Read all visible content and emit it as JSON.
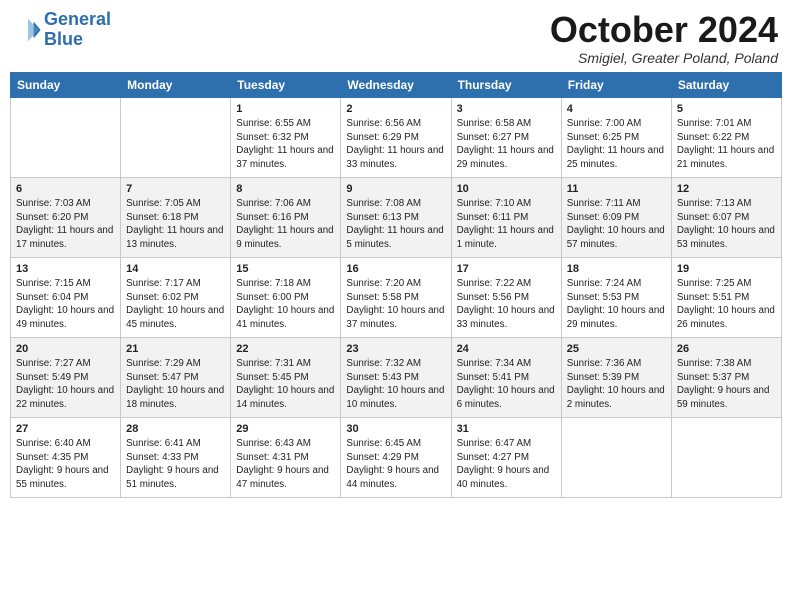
{
  "header": {
    "logo_line1": "General",
    "logo_line2": "Blue",
    "month": "October 2024",
    "location": "Smigiel, Greater Poland, Poland"
  },
  "weekdays": [
    "Sunday",
    "Monday",
    "Tuesday",
    "Wednesday",
    "Thursday",
    "Friday",
    "Saturday"
  ],
  "weeks": [
    [
      {
        "day": "",
        "info": ""
      },
      {
        "day": "",
        "info": ""
      },
      {
        "day": "1",
        "info": "Sunrise: 6:55 AM\nSunset: 6:32 PM\nDaylight: 11 hours and 37 minutes."
      },
      {
        "day": "2",
        "info": "Sunrise: 6:56 AM\nSunset: 6:29 PM\nDaylight: 11 hours and 33 minutes."
      },
      {
        "day": "3",
        "info": "Sunrise: 6:58 AM\nSunset: 6:27 PM\nDaylight: 11 hours and 29 minutes."
      },
      {
        "day": "4",
        "info": "Sunrise: 7:00 AM\nSunset: 6:25 PM\nDaylight: 11 hours and 25 minutes."
      },
      {
        "day": "5",
        "info": "Sunrise: 7:01 AM\nSunset: 6:22 PM\nDaylight: 11 hours and 21 minutes."
      }
    ],
    [
      {
        "day": "6",
        "info": "Sunrise: 7:03 AM\nSunset: 6:20 PM\nDaylight: 11 hours and 17 minutes."
      },
      {
        "day": "7",
        "info": "Sunrise: 7:05 AM\nSunset: 6:18 PM\nDaylight: 11 hours and 13 minutes."
      },
      {
        "day": "8",
        "info": "Sunrise: 7:06 AM\nSunset: 6:16 PM\nDaylight: 11 hours and 9 minutes."
      },
      {
        "day": "9",
        "info": "Sunrise: 7:08 AM\nSunset: 6:13 PM\nDaylight: 11 hours and 5 minutes."
      },
      {
        "day": "10",
        "info": "Sunrise: 7:10 AM\nSunset: 6:11 PM\nDaylight: 11 hours and 1 minute."
      },
      {
        "day": "11",
        "info": "Sunrise: 7:11 AM\nSunset: 6:09 PM\nDaylight: 10 hours and 57 minutes."
      },
      {
        "day": "12",
        "info": "Sunrise: 7:13 AM\nSunset: 6:07 PM\nDaylight: 10 hours and 53 minutes."
      }
    ],
    [
      {
        "day": "13",
        "info": "Sunrise: 7:15 AM\nSunset: 6:04 PM\nDaylight: 10 hours and 49 minutes."
      },
      {
        "day": "14",
        "info": "Sunrise: 7:17 AM\nSunset: 6:02 PM\nDaylight: 10 hours and 45 minutes."
      },
      {
        "day": "15",
        "info": "Sunrise: 7:18 AM\nSunset: 6:00 PM\nDaylight: 10 hours and 41 minutes."
      },
      {
        "day": "16",
        "info": "Sunrise: 7:20 AM\nSunset: 5:58 PM\nDaylight: 10 hours and 37 minutes."
      },
      {
        "day": "17",
        "info": "Sunrise: 7:22 AM\nSunset: 5:56 PM\nDaylight: 10 hours and 33 minutes."
      },
      {
        "day": "18",
        "info": "Sunrise: 7:24 AM\nSunset: 5:53 PM\nDaylight: 10 hours and 29 minutes."
      },
      {
        "day": "19",
        "info": "Sunrise: 7:25 AM\nSunset: 5:51 PM\nDaylight: 10 hours and 26 minutes."
      }
    ],
    [
      {
        "day": "20",
        "info": "Sunrise: 7:27 AM\nSunset: 5:49 PM\nDaylight: 10 hours and 22 minutes."
      },
      {
        "day": "21",
        "info": "Sunrise: 7:29 AM\nSunset: 5:47 PM\nDaylight: 10 hours and 18 minutes."
      },
      {
        "day": "22",
        "info": "Sunrise: 7:31 AM\nSunset: 5:45 PM\nDaylight: 10 hours and 14 minutes."
      },
      {
        "day": "23",
        "info": "Sunrise: 7:32 AM\nSunset: 5:43 PM\nDaylight: 10 hours and 10 minutes."
      },
      {
        "day": "24",
        "info": "Sunrise: 7:34 AM\nSunset: 5:41 PM\nDaylight: 10 hours and 6 minutes."
      },
      {
        "day": "25",
        "info": "Sunrise: 7:36 AM\nSunset: 5:39 PM\nDaylight: 10 hours and 2 minutes."
      },
      {
        "day": "26",
        "info": "Sunrise: 7:38 AM\nSunset: 5:37 PM\nDaylight: 9 hours and 59 minutes."
      }
    ],
    [
      {
        "day": "27",
        "info": "Sunrise: 6:40 AM\nSunset: 4:35 PM\nDaylight: 9 hours and 55 minutes."
      },
      {
        "day": "28",
        "info": "Sunrise: 6:41 AM\nSunset: 4:33 PM\nDaylight: 9 hours and 51 minutes."
      },
      {
        "day": "29",
        "info": "Sunrise: 6:43 AM\nSunset: 4:31 PM\nDaylight: 9 hours and 47 minutes."
      },
      {
        "day": "30",
        "info": "Sunrise: 6:45 AM\nSunset: 4:29 PM\nDaylight: 9 hours and 44 minutes."
      },
      {
        "day": "31",
        "info": "Sunrise: 6:47 AM\nSunset: 4:27 PM\nDaylight: 9 hours and 40 minutes."
      },
      {
        "day": "",
        "info": ""
      },
      {
        "day": "",
        "info": ""
      }
    ]
  ]
}
